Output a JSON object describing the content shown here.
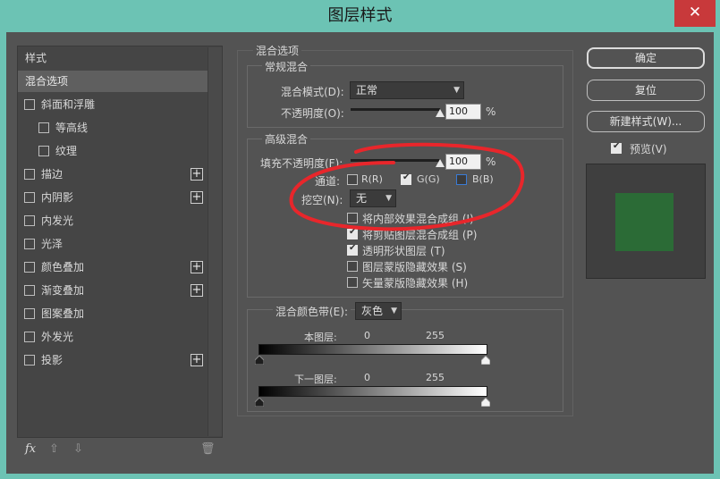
{
  "window": {
    "title": "图层样式",
    "close": "✕"
  },
  "left": {
    "header": "样式",
    "selected": "混合选项",
    "items": [
      {
        "label": "斜面和浮雕",
        "checked": false,
        "plus": false
      },
      {
        "label": "等高线",
        "checked": false,
        "plus": false
      },
      {
        "label": "纹理",
        "checked": false,
        "plus": false
      },
      {
        "label": "描边",
        "checked": false,
        "plus": true
      },
      {
        "label": "内阴影",
        "checked": false,
        "plus": true
      },
      {
        "label": "内发光",
        "checked": false,
        "plus": false
      },
      {
        "label": "光泽",
        "checked": false,
        "plus": false
      },
      {
        "label": "颜色叠加",
        "checked": false,
        "plus": true
      },
      {
        "label": "渐变叠加",
        "checked": false,
        "plus": true
      },
      {
        "label": "图案叠加",
        "checked": false,
        "plus": false
      },
      {
        "label": "外发光",
        "checked": false,
        "plus": false
      },
      {
        "label": "投影",
        "checked": false,
        "plus": true
      }
    ],
    "footer": {
      "fx": "fx",
      "up": "⇧",
      "down": "⇩",
      "trash": "🗑"
    }
  },
  "main": {
    "section_title": "混合选项",
    "general": {
      "title": "常规混合",
      "blend_mode_label": "混合模式(D):",
      "blend_mode_value": "正常",
      "opacity_label": "不透明度(O):",
      "opacity_value": "100",
      "opacity_unit": "%",
      "opacity_level": 1.0
    },
    "advanced": {
      "title": "高级混合",
      "fill_label": "填充不透明度(F):",
      "fill_value": "100",
      "fill_unit": "%",
      "fill_level": 1.0,
      "channels_label": "通道:",
      "channel_r": "R(R)",
      "channel_g": "G(G)",
      "channel_b": "B(B)",
      "channel_r_checked": false,
      "channel_g_checked": true,
      "channel_b_checked": false,
      "knockout_label": "挖空(N):",
      "knockout_value": "无",
      "options": [
        {
          "label": "将内部效果混合成组 (I)",
          "checked": false
        },
        {
          "label": "将剪贴图层混合成组 (P)",
          "checked": true
        },
        {
          "label": "透明形状图层 (T)",
          "checked": true
        },
        {
          "label": "图层蒙版隐藏效果 (S)",
          "checked": false
        },
        {
          "label": "矢量蒙版隐藏效果 (H)",
          "checked": false
        }
      ]
    },
    "blendif": {
      "label": "混合颜色带(E):",
      "value": "灰色",
      "this_layer_label": "本图层:",
      "this_layer_min": "0",
      "this_layer_max": "255",
      "under_layer_label": "下一图层:",
      "under_layer_min": "0",
      "under_layer_max": "255"
    }
  },
  "right": {
    "ok": "确定",
    "reset": "复位",
    "new_style": "新建样式(W)...",
    "preview_label": "预览(V)",
    "preview_checked": true,
    "preview_color": "#2b6b36"
  },
  "colors": {
    "accent_red": "#e8262b",
    "close_red": "#c8393b",
    "title_bar": "#6cc3b4"
  }
}
